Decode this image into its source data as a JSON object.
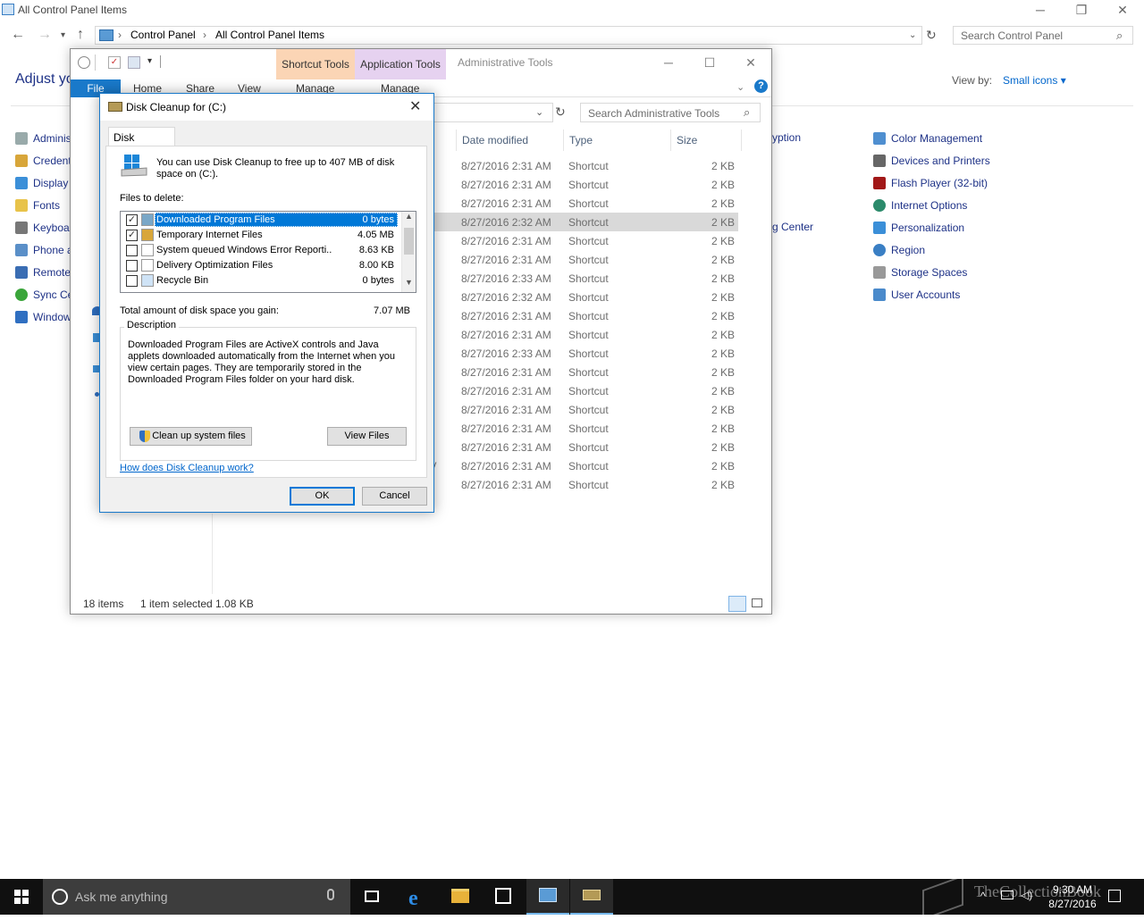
{
  "control_panel": {
    "title": "All Control Panel Items",
    "breadcrumb": [
      "Control Panel",
      "All Control Panel Items"
    ],
    "search_placeholder": "Search Control Panel",
    "heading": "Adjust yo",
    "view_by_label": "View by:",
    "view_by_value": "Small icons ▾",
    "left_items": [
      "Adminis",
      "Credent",
      "Display",
      "Fonts",
      "Keyboa",
      "Phone a",
      "Remote",
      "Sync Ce",
      "Window"
    ],
    "right_items": [
      "Color Management",
      "Devices and Printers",
      "Flash Player (32-bit)",
      "Internet Options",
      "Personalization",
      "Region",
      "Storage Spaces",
      "User Accounts"
    ],
    "middle_fragments": [
      "yption",
      "g Center"
    ]
  },
  "explorer": {
    "title": "Administrative Tools",
    "tool_tabs": [
      "Shortcut Tools",
      "Application Tools"
    ],
    "ribbon": [
      "File",
      "Home",
      "Share",
      "View",
      "Manage",
      "Manage"
    ],
    "search_placeholder": "Search Administrative Tools",
    "columns": [
      "Date modified",
      "Type",
      "Size"
    ],
    "rows": [
      {
        "date": "8/27/2016 2:31 AM",
        "type": "Shortcut",
        "size": "2 KB"
      },
      {
        "date": "8/27/2016 2:31 AM",
        "type": "Shortcut",
        "size": "2 KB"
      },
      {
        "date": "8/27/2016 2:31 AM",
        "type": "Shortcut",
        "size": "2 KB"
      },
      {
        "date": "8/27/2016 2:32 AM",
        "type": "Shortcut",
        "size": "2 KB"
      },
      {
        "date": "8/27/2016 2:31 AM",
        "type": "Shortcut",
        "size": "2 KB"
      },
      {
        "date": "8/27/2016 2:31 AM",
        "type": "Shortcut",
        "size": "2 KB"
      },
      {
        "date": "8/27/2016 2:33 AM",
        "type": "Shortcut",
        "size": "2 KB"
      },
      {
        "date": "8/27/2016 2:32 AM",
        "type": "Shortcut",
        "size": "2 KB"
      },
      {
        "date": "8/27/2016 2:31 AM",
        "type": "Shortcut",
        "size": "2 KB"
      },
      {
        "date": "8/27/2016 2:31 AM",
        "type": "Shortcut",
        "size": "2 KB"
      },
      {
        "date": "8/27/2016 2:33 AM",
        "type": "Shortcut",
        "size": "2 KB"
      },
      {
        "date": "8/27/2016 2:31 AM",
        "type": "Shortcut",
        "size": "2 KB"
      },
      {
        "date": "8/27/2016 2:31 AM",
        "type": "Shortcut",
        "size": "2 KB"
      },
      {
        "date": "8/27/2016 2:31 AM",
        "type": "Shortcut",
        "size": "2 KB"
      },
      {
        "date": "8/27/2016 2:31 AM",
        "type": "Shortcut",
        "size": "2 KB"
      },
      {
        "date": "8/27/2016 2:31 AM",
        "type": "Shortcut",
        "size": "2 KB"
      },
      {
        "date": "8/27/2016 2:31 AM",
        "type": "Shortcut",
        "size": "2 KB"
      },
      {
        "date": "8/27/2016 2:31 AM",
        "type": "Shortcut",
        "size": "2 KB"
      }
    ],
    "row_fragment": "ty",
    "status_count": "18 items",
    "status_selected": "1 item selected  1.08 KB"
  },
  "dialog": {
    "title": "Disk Cleanup for  (C:)",
    "tab": "Disk Cleanup",
    "message": "You can use Disk Cleanup to free up to 407 MB of disk space on  (C:).",
    "files_label": "Files to delete:",
    "files": [
      {
        "checked": true,
        "name": "Downloaded Program Files",
        "size": "0 bytes",
        "icon": "folder-icon"
      },
      {
        "checked": true,
        "name": "Temporary Internet Files",
        "size": "4.05 MB",
        "icon": "lock-icon"
      },
      {
        "checked": false,
        "name": "System queued Windows Error Reporti...",
        "size": "8.63 KB",
        "icon": "file-icon"
      },
      {
        "checked": false,
        "name": "Delivery Optimization Files",
        "size": "8.00 KB",
        "icon": "file-icon"
      },
      {
        "checked": false,
        "name": "Recycle Bin",
        "size": "0 bytes",
        "icon": "recycle-bin-icon"
      }
    ],
    "total_label": "Total amount of disk space you gain:",
    "total_value": "7.07 MB",
    "description_title": "Description",
    "description": "Downloaded Program Files are ActiveX controls and Java applets downloaded automatically from the Internet when you view certain pages. They are temporarily stored in the Downloaded Program Files folder on your hard disk.",
    "cleanup_button": "Clean up system files",
    "view_files_button": "View Files",
    "help_link": "How does Disk Cleanup work?",
    "ok": "OK",
    "cancel": "Cancel"
  },
  "taskbar": {
    "search_placeholder": "Ask me anything",
    "time": "9:30 AM",
    "date": "8/27/2016",
    "watermark": "TheCollectionBook"
  }
}
